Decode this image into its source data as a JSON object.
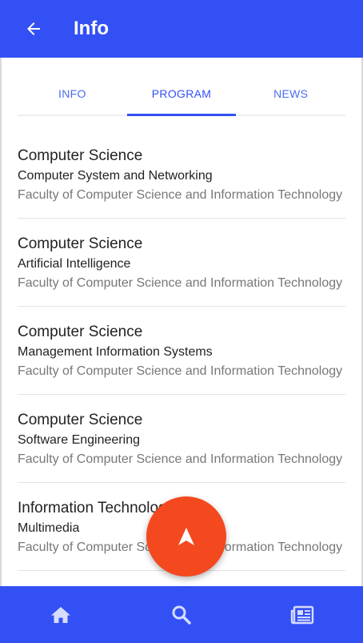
{
  "app_bar": {
    "title": "Info",
    "back_icon": "arrow-left-icon"
  },
  "tabs": [
    {
      "label": "INFO",
      "active": false
    },
    {
      "label": "PROGRAM",
      "active": true
    },
    {
      "label": "NEWS",
      "active": false
    }
  ],
  "programs": [
    {
      "field": "Computer Science",
      "program": "Computer System and Networking",
      "faculty": "Faculty of Computer Science and Information Technology"
    },
    {
      "field": "Computer Science",
      "program": "Artificial Intelligence",
      "faculty": "Faculty of Computer Science and Information Technology"
    },
    {
      "field": "Computer Science",
      "program": "Management Information Systems",
      "faculty": "Faculty of Computer Science and Information Technology"
    },
    {
      "field": "Computer Science",
      "program": "Software Engineering",
      "faculty": "Faculty of Computer Science and Information Technology"
    },
    {
      "field": "Information Technology",
      "program": "Multimedia",
      "faculty": "Faculty of Computer Science and Information Technology"
    }
  ],
  "fab": {
    "icon": "navigation-arrow-icon"
  },
  "bottom_nav": [
    {
      "icon": "home-icon"
    },
    {
      "icon": "search-icon"
    },
    {
      "icon": "newspaper-icon"
    }
  ],
  "colors": {
    "primary": "#3350f5",
    "accent": "#f4481f"
  }
}
